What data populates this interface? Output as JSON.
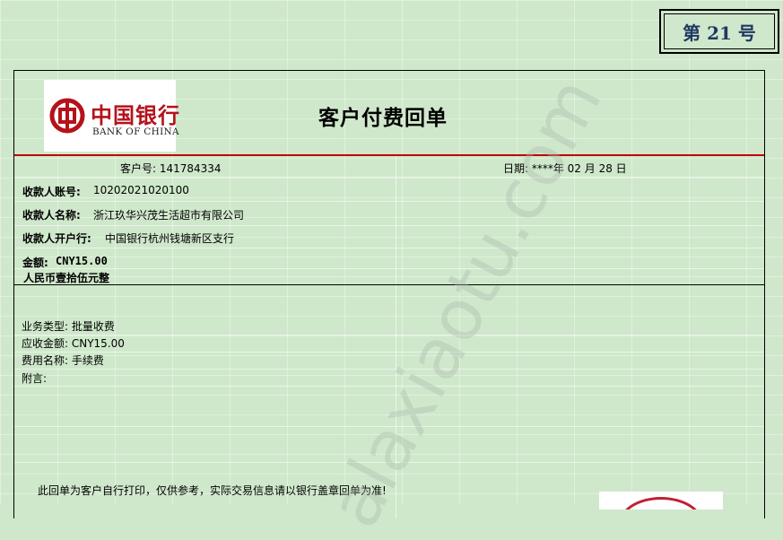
{
  "sequence": {
    "label": "第 21 号"
  },
  "bank": {
    "name_cn": "中国银行",
    "name_en": "BANK OF CHINA"
  },
  "receipt": {
    "title": "客户付费回单",
    "customer_no": "客户号: 141784334",
    "date": "日期: ****年 02 月 28 日",
    "payee_account_label": "收款人账号:",
    "payee_account": "10202021020100",
    "payee_name_label": "收款人名称:",
    "payee_name": "浙江玖华兴茂生活超市有限公司",
    "payee_bank_label": "收款人开户行:",
    "payee_bank": "中国银行杭州钱塘新区支行",
    "amount_label": "金额:",
    "amount": "CNY15.00",
    "amount_words": "人民币壹拾伍元整",
    "business_type": "业务类型: 批量收费",
    "amount_due": "应收金额: CNY15.00",
    "fee_name": "费用名称: 手续费",
    "remark": "附言:",
    "footer_note": "此回单为客户自行打印，仅供参考，实际交易信息请以银行盖章回单为准!"
  },
  "watermark": "alaxiaotu.com",
  "colors": {
    "background": "#cfe8cb",
    "bank_red": "#b5121b",
    "divider_red": "#c00000",
    "sequence_text": "#1f3864"
  }
}
